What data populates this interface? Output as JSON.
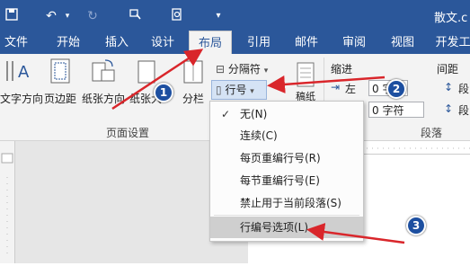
{
  "window": {
    "title": "散文.c"
  },
  "quick_access": [
    "save-icon",
    "undo-icon",
    "redo-icon",
    "touch-mode-icon",
    "print-preview-icon",
    "customize-icon"
  ],
  "tabs": [
    {
      "label": "文件"
    },
    {
      "label": "开始"
    },
    {
      "label": "插入"
    },
    {
      "label": "设计"
    },
    {
      "label": "布局",
      "active": true
    },
    {
      "label": "引用"
    },
    {
      "label": "邮件"
    },
    {
      "label": "审阅"
    },
    {
      "label": "视图"
    },
    {
      "label": "开发工"
    }
  ],
  "ribbon": {
    "text_direction": "文字方向",
    "margins": "页边距",
    "orientation": "纸张方向",
    "size": "纸张大",
    "columns": "分栏",
    "breaks": "分隔符",
    "line_numbers": "行号",
    "hyphenation": "稿纸",
    "indent_header": "缩进",
    "indent_left_label": "左",
    "indent_left_value": "0 字",
    "indent_right_value": "0 字符",
    "spacing_header": "间距",
    "spacing_before": "段",
    "spacing_after": "段",
    "group_page_setup": "页面设置",
    "group_paragraph": "段落"
  },
  "menu": {
    "items": [
      {
        "label": "无(N)",
        "checked": true
      },
      {
        "label": "连续(C)"
      },
      {
        "label": "每页重编行号(R)"
      },
      {
        "label": "每节重编行号(E)"
      },
      {
        "label": "禁止用于当前段落(S)"
      },
      {
        "label": "行编号选项(L)...",
        "highlighted": true
      }
    ]
  },
  "annotations": {
    "step1": "1",
    "step2": "2",
    "step3": "3"
  },
  "colors": {
    "accent": "#2b579a",
    "arrow": "#d9262b",
    "badge": "#1d4fa0"
  }
}
